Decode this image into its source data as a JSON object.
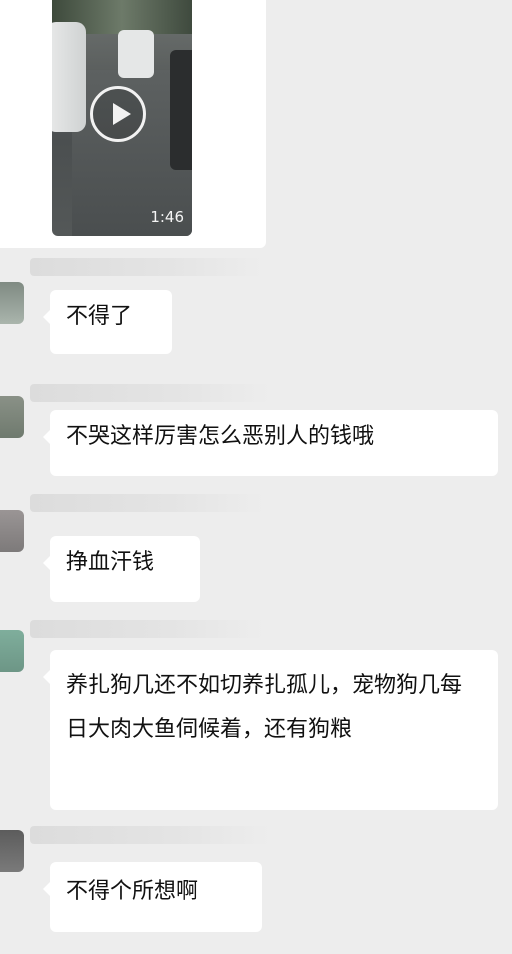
{
  "video": {
    "duration": "1:46"
  },
  "messages": [
    {
      "text": "不得了"
    },
    {
      "text": "不哭这样厉害怎么恶别人的钱哦"
    },
    {
      "text": "挣血汗钱"
    },
    {
      "text": "养扎狗几还不如切养扎孤儿，宠物狗几每日大肉大鱼伺候着，还有狗粮"
    },
    {
      "text": "不得个所想啊"
    }
  ],
  "colors": {
    "background": "#ededed",
    "bubble": "#ffffff",
    "text": "#111111"
  }
}
